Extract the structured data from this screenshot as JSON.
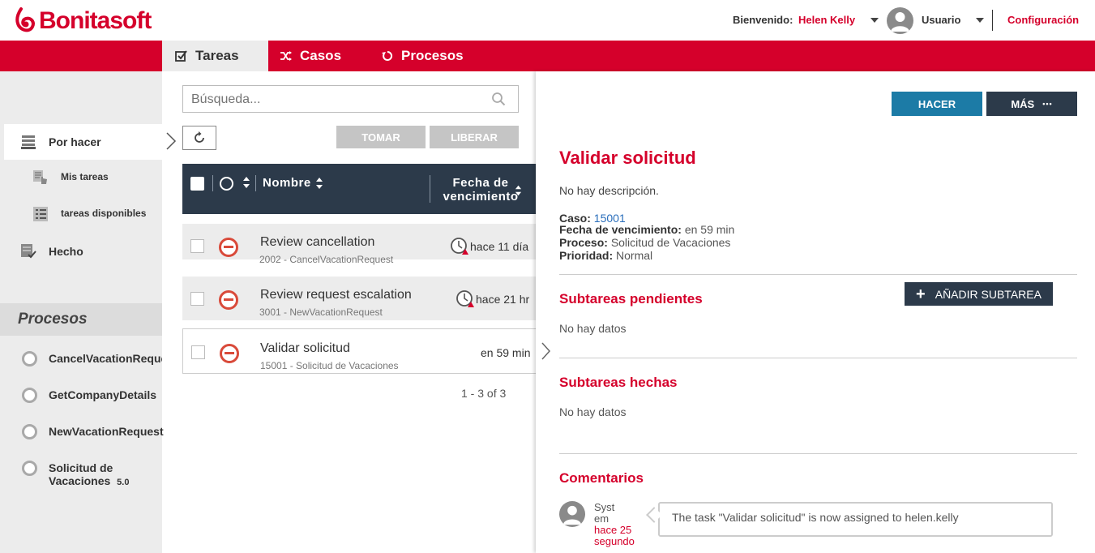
{
  "brand": {
    "name": "Bonitasoft",
    "color": "#d5002b"
  },
  "header": {
    "welcome_label": "Bienvenido:",
    "user_name": "Helen Kelly",
    "profile_label": "Usuario",
    "settings_label": "Configuración"
  },
  "nav": {
    "tabs": [
      {
        "label": "Tareas",
        "active": true
      },
      {
        "label": "Casos",
        "active": false
      },
      {
        "label": "Procesos",
        "active": false
      }
    ]
  },
  "sidebar": {
    "filters": [
      {
        "label": "Por hacer",
        "selected": true
      },
      {
        "label": "Mis tareas"
      },
      {
        "label": "tareas disponibles"
      },
      {
        "label": "Hecho"
      }
    ],
    "processes_title": "Procesos",
    "processes": [
      {
        "label": "CancelVacationReque"
      },
      {
        "label": "GetCompanyDetails"
      },
      {
        "label": "NewVacationRequest"
      },
      {
        "label": "Solicitud de Vacaciones",
        "label_line1": "Solicitud de",
        "label_line2": "Vacaciones",
        "version": "5.0"
      }
    ]
  },
  "tasklist": {
    "search_placeholder": "Búsqueda...",
    "take_label": "TOMAR",
    "release_label": "LIBERAR",
    "columns": {
      "name": "Nombre",
      "due_line1": "Fecha de",
      "due_line2": "vencimiento"
    },
    "rows": [
      {
        "name": "Review cancellation",
        "sub": "2002 - CancelVacationRequest",
        "due": "hace 11 día",
        "overdue": true
      },
      {
        "name": "Review request escalation",
        "sub": "3001 - NewVacationRequest",
        "due": "hace 21 hr",
        "overdue": true
      },
      {
        "name": "Validar solicitud",
        "sub": "15001 - Solicitud de Vacaciones",
        "due": "en 59 min",
        "overdue": false
      }
    ],
    "pager": "1 - 3 of 3"
  },
  "detail": {
    "do_label": "HACER",
    "more_label": "MÁS",
    "more_dots": "•••",
    "title": "Validar solicitud",
    "description": "No hay descripción.",
    "case_label": "Caso:",
    "case_value": "15001",
    "due_label": "Fecha de vencimiento:",
    "due_value": "en 59 min",
    "process_label": "Proceso:",
    "process_value": "Solicitud de Vacaciones",
    "priority_label": "Prioridad:",
    "priority_value": "Normal",
    "pending_subtasks_title": "Subtareas pendientes",
    "add_subtask_label": "AÑADIR SUBTAREA",
    "pending_empty": "No hay datos",
    "done_subtasks_title": "Subtareas hechas",
    "done_empty": "No hay datos",
    "comments_title": "Comentarios",
    "comment": {
      "author_line1": "Syst",
      "author_line2": "em",
      "time_line1": "hace 25",
      "time_line2": "segundo",
      "text": "The task \"Validar solicitud\" is now assigned to helen.kelly"
    }
  }
}
